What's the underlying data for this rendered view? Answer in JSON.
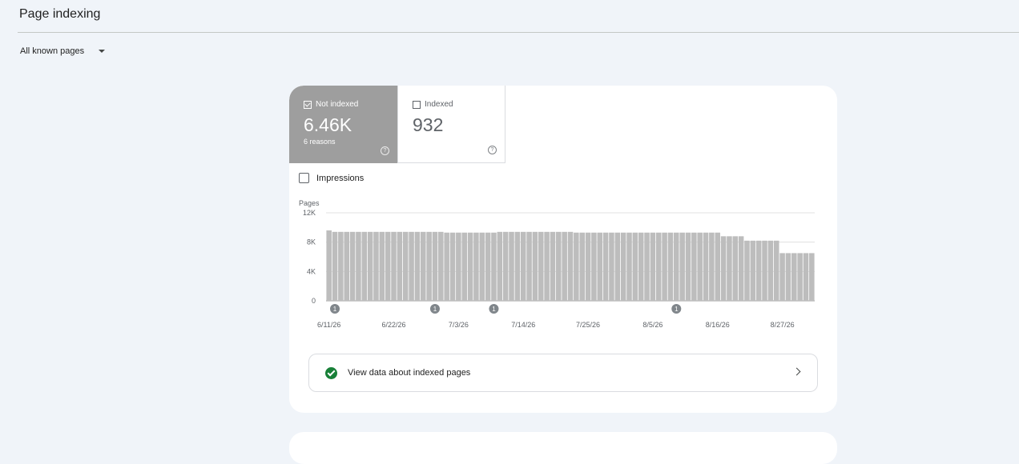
{
  "page": {
    "title": "Page indexing"
  },
  "filter": {
    "label": "All known pages"
  },
  "tiles": [
    {
      "label": "Not indexed",
      "value": "6.46K",
      "sub": "6 reasons",
      "checked": true
    },
    {
      "label": "Indexed",
      "value": "932",
      "checked": false
    }
  ],
  "impressions": {
    "label": "Impressions"
  },
  "view_data": {
    "label": "View data about indexed pages"
  },
  "chart_data": {
    "type": "bar",
    "ylabel": "Pages",
    "yticks": [
      "0",
      "4K",
      "8K",
      "12K"
    ],
    "ylim": [
      0,
      12000
    ],
    "xticks": [
      "6/11/26",
      "6/22/26",
      "7/3/26",
      "7/14/26",
      "7/25/26",
      "8/5/26",
      "8/16/26",
      "8/27/26"
    ],
    "annotations": [
      "1",
      "1",
      "1",
      "1"
    ],
    "values": [
      9600,
      9400,
      9400,
      9400,
      9400,
      9400,
      9400,
      9400,
      9400,
      9400,
      9400,
      9400,
      9400,
      9400,
      9400,
      9400,
      9400,
      9400,
      9400,
      9400,
      9300,
      9300,
      9300,
      9300,
      9300,
      9300,
      9300,
      9300,
      9300,
      9400,
      9400,
      9400,
      9400,
      9400,
      9400,
      9400,
      9400,
      9400,
      9400,
      9400,
      9400,
      9400,
      9300,
      9300,
      9300,
      9300,
      9300,
      9300,
      9300,
      9300,
      9300,
      9300,
      9300,
      9300,
      9300,
      9300,
      9300,
      9300,
      9300,
      9300,
      9300,
      9300,
      9300,
      9300,
      9300,
      9300,
      9300,
      8800,
      8800,
      8800,
      8800,
      8200,
      8200,
      8200,
      8200,
      8200,
      8200,
      6500,
      6500,
      6500,
      6500,
      6500,
      6500
    ],
    "grid": true
  }
}
